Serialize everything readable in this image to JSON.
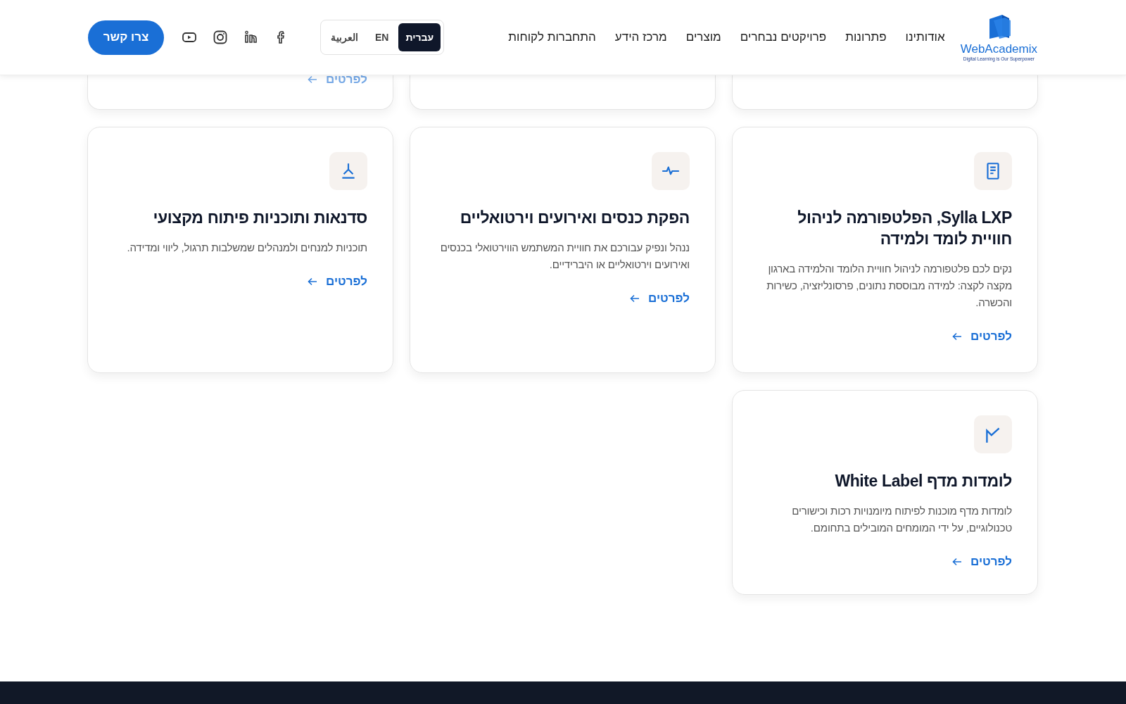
{
  "header": {
    "logo": {
      "name": "WebAcademix",
      "tagline": "Digital Learning is Our Superpower"
    },
    "nav": [
      "אודותינו",
      "פתרונות",
      "פרויקטים נבחרים",
      "מוצרים",
      "מרכז הידע",
      "התחברות לקוחות"
    ],
    "languages": [
      {
        "label": "עברית",
        "selected": true
      },
      {
        "label": "EN",
        "selected": false
      },
      {
        "label": "العربية",
        "selected": false
      }
    ],
    "social": [
      {
        "kind": "facebook"
      },
      {
        "kind": "linkedin"
      },
      {
        "kind": "instagram"
      },
      {
        "kind": "youtube"
      }
    ],
    "contact_button": "צרו קשר"
  },
  "cut_cards": [
    {
      "kind": "plain"
    },
    {
      "kind": "plain"
    },
    {
      "kind": "link",
      "link": "לפרטים"
    }
  ],
  "cards": [
    {
      "kind": "document",
      "title": "Sylla LXP, הפלטפורמה לניהול חוויית לומד ולמידה",
      "description": "נקים לכם פלטפורמה לניהול חוויית הלומד והלמידה בארגון מקצה לקצה: למידה מבוססת נתונים, פרסונליזציה, כשירות והכשרה.",
      "link": "לפרטים"
    },
    {
      "kind": "pulse",
      "title": "הפקת כנסים ואירועים וירטואליים",
      "description": "ננהל ונפיק עבורכם את חוויית המשתמש הווירטואלי בכנסים ואירועים וירטואליים או היברידיים.",
      "link": "לפרטים"
    },
    {
      "kind": "merge",
      "title": "סדנאות ותוכניות פיתוח מקצועי",
      "description": "תוכניות למנחים ולמנהלים שמשלבות תרגול, ליווי ומדידה.",
      "link": "לפרטים"
    },
    {
      "kind": "check",
      "title": "לומדות מדף White Label",
      "description": "לומדות מדף מוכנות לפיתוח מיומנויות רכות וכישורים טכנולוגיים, על ידי המומחים המובילים בתחומם.",
      "link": "לפרטים"
    }
  ]
}
